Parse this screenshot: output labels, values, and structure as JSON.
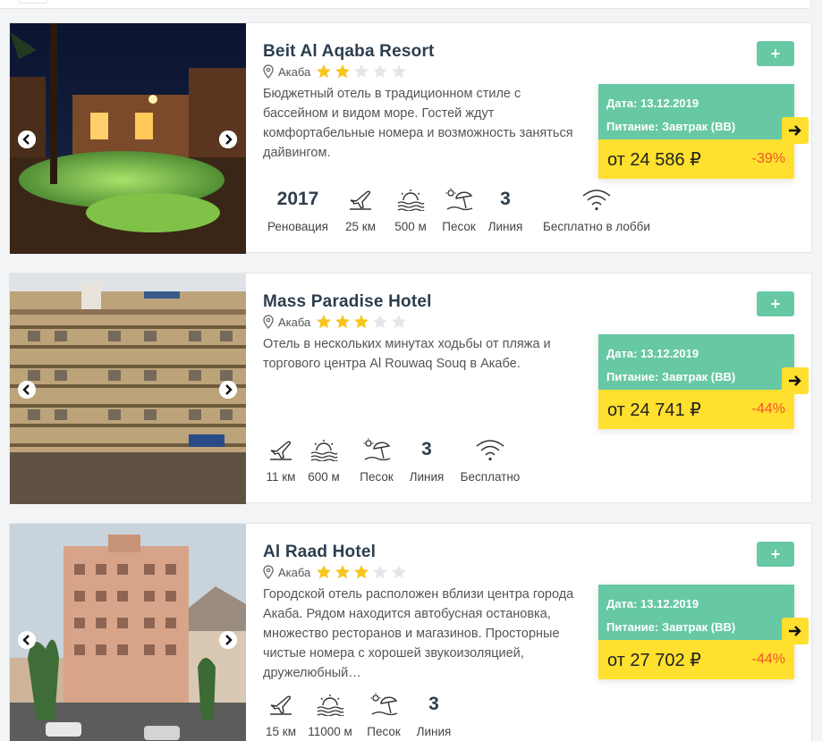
{
  "currency": "₽",
  "colors": {
    "accent": "#67c8a4",
    "price_bg": "#ffe02e",
    "discount": "#f0552b",
    "title": "#2c3e4e"
  },
  "hotels": [
    {
      "name": "Beit Al Aqaba Resort",
      "city": "Акаба",
      "stars": 2,
      "max_stars": 5,
      "description": "Бюджетный отель в традиционном стиле с бассейном и видом море. Гостей ждут комфортабельные номера и возможность заняться дайвингом.",
      "renovation_value": "2017",
      "renovation_label": "Реновация",
      "airport": "25 км",
      "beach_distance": "500 м",
      "beach_type": "Песок",
      "line_value": "3",
      "line_label": "Линия",
      "wifi": "Бесплатно в лобби",
      "date_text": "Дата: 13.12.2019",
      "meal_text": "Питание: Завтрак (BB)",
      "price": "от 24 586 ₽",
      "discount": "-39%",
      "add_label": "+"
    },
    {
      "name": "Mass Paradise Hotel",
      "city": "Акаба",
      "stars": 3,
      "max_stars": 5,
      "description": "Отель в нескольких минутах ходьбы от пляжа и торгового центра Al Rouwaq Souq в Акабе.",
      "airport": "11 км",
      "beach_distance": "600 м",
      "beach_type": "Песок",
      "line_value": "3",
      "line_label": "Линия",
      "wifi": "Бесплатно",
      "date_text": "Дата: 13.12.2019",
      "meal_text": "Питание: Завтрак (BB)",
      "price": "от 24 741 ₽",
      "discount": "-44%",
      "add_label": "+"
    },
    {
      "name": "Al Raad Hotel",
      "city": "Акаба",
      "stars": 3,
      "max_stars": 5,
      "description": "Городской отель расположен вблизи центра города Акаба. Рядом находится автобусная остановка, множество ресторанов и магазинов. Просторные чистые номера с хорошей звукоизоляцией, дружелюбный…",
      "airport": "15 км",
      "beach_distance": "11000 м",
      "beach_type": "Песок",
      "line_value": "3",
      "line_label": "Линия",
      "date_text": "Дата: 13.12.2019",
      "meal_text": "Питание: Завтрак (BB)",
      "price": "от 27 702 ₽",
      "discount": "-44%",
      "add_label": "+"
    }
  ]
}
